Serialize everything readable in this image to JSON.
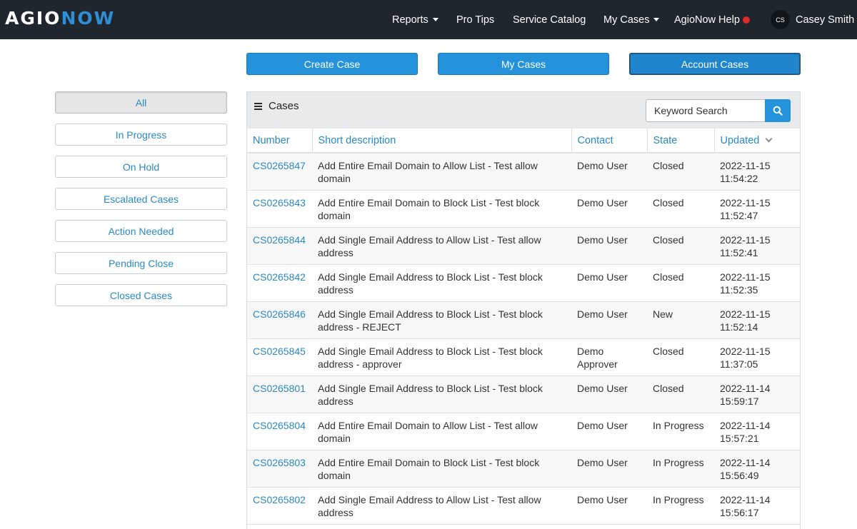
{
  "header": {
    "logo_part1": "AGIO",
    "logo_part2": "NOW",
    "nav": {
      "reports": "Reports",
      "pro_tips": "Pro Tips",
      "service_catalog": "Service Catalog",
      "my_cases": "My Cases",
      "help": "AgioNow Help"
    },
    "user": {
      "initials": "CS",
      "name": "Casey Smith"
    }
  },
  "actions": {
    "create_case": "Create Case",
    "my_cases": "My Cases",
    "account_cases": "Account Cases"
  },
  "filters": [
    "All",
    "In Progress",
    "On Hold",
    "Escalated Cases",
    "Action Needed",
    "Pending Close",
    "Closed Cases"
  ],
  "cases": {
    "title": "Cases",
    "search_placeholder": "Keyword Search",
    "columns": {
      "number": "Number",
      "short_description": "Short description",
      "contact": "Contact",
      "state": "State",
      "updated": "Updated"
    },
    "rows": [
      {
        "number": "CS0265847",
        "description": "Add Entire Email Domain to Allow List - Test allow domain",
        "contact": "Demo User",
        "state": "Closed",
        "updated": "2022-11-15 11:54:22"
      },
      {
        "number": "CS0265843",
        "description": "Add Entire Email Domain to Block List - Test block domain",
        "contact": "Demo User",
        "state": "Closed",
        "updated": "2022-11-15 11:52:47"
      },
      {
        "number": "CS0265844",
        "description": "Add Single Email Address to Allow List - Test allow address",
        "contact": "Demo User",
        "state": "Closed",
        "updated": "2022-11-15 11:52:41"
      },
      {
        "number": "CS0265842",
        "description": "Add Single Email Address to Block List - Test block address",
        "contact": "Demo User",
        "state": "Closed",
        "updated": "2022-11-15 11:52:35"
      },
      {
        "number": "CS0265846",
        "description": "Add Single Email Address to Block List - Test block address - REJECT",
        "contact": "Demo User",
        "state": "New",
        "updated": "2022-11-15 11:52:14"
      },
      {
        "number": "CS0265845",
        "description": "Add Single Email Address to Block List - Test block address - approver",
        "contact": "Demo Approver",
        "state": "Closed",
        "updated": "2022-11-15 11:37:05"
      },
      {
        "number": "CS0265801",
        "description": "Add Single Email Address to Block List - Test block address",
        "contact": "Demo User",
        "state": "Closed",
        "updated": "2022-11-14 15:59:17"
      },
      {
        "number": "CS0265804",
        "description": "Add Entire Email Domain to Allow List - Test allow domain",
        "contact": "Demo User",
        "state": "In Progress",
        "updated": "2022-11-14 15:57:21"
      },
      {
        "number": "CS0265803",
        "description": "Add Entire Email Domain to Block List - Test block domain",
        "contact": "Demo User",
        "state": "In Progress",
        "updated": "2022-11-14 15:56:49"
      },
      {
        "number": "CS0265802",
        "description": "Add Single Email Address to Allow List - Test allow address",
        "contact": "Demo User",
        "state": "In Progress",
        "updated": "2022-11-14 15:56:17"
      }
    ]
  }
}
